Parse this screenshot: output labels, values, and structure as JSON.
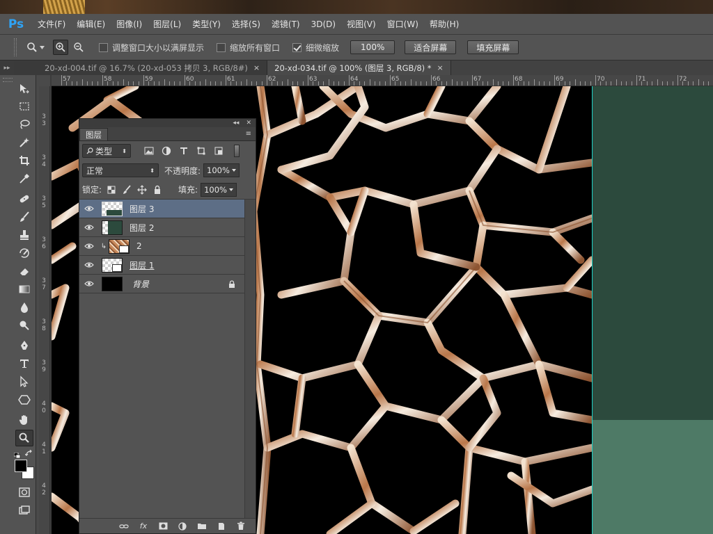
{
  "app": {
    "logo": "Ps"
  },
  "menu": [
    "文件(F)",
    "编辑(E)",
    "图像(I)",
    "图层(L)",
    "类型(Y)",
    "选择(S)",
    "滤镜(T)",
    "3D(D)",
    "视图(V)",
    "窗口(W)",
    "帮助(H)"
  ],
  "options": {
    "resize_windows": {
      "label": "调整窗口大小以满屏显示",
      "checked": false
    },
    "zoom_all": {
      "label": "缩放所有窗口",
      "checked": false
    },
    "scrubby_zoom": {
      "label": "细微缩放",
      "checked": true
    },
    "btn_100": "100%",
    "btn_fit": "适合屏幕",
    "btn_fill": "填充屏幕"
  },
  "tabs": [
    {
      "label": "20-xd-004.tif @ 16.7% (20-xd-053 拷贝 3, RGB/8#)",
      "close": "×",
      "active": false
    },
    {
      "label": "20-xd-034.tif @ 100% (图层 3, RGB/8) *",
      "close": "×",
      "active": true
    }
  ],
  "ruler_top": [
    "57",
    "58",
    "59",
    "60",
    "61",
    "62",
    "63",
    "64",
    "65",
    "66",
    "67",
    "68",
    "69",
    "70",
    "71",
    "72"
  ],
  "ruler_left": [
    "3",
    "3",
    "3",
    "4",
    "3",
    "5",
    "3",
    "6",
    "3",
    "7",
    "3",
    "8",
    "3",
    "9",
    "4",
    "0",
    "4",
    "1",
    "4",
    "2"
  ],
  "layers_panel": {
    "title": "图层",
    "filter_kind": "类型",
    "blend_mode": "正常",
    "opacity_label": "不透明度:",
    "opacity_value": "100%",
    "lock_label": "锁定:",
    "fill_label": "填充:",
    "fill_value": "100%",
    "layers": [
      {
        "name": "图层 3",
        "selected": true,
        "thumb": "checker-green"
      },
      {
        "name": "图层 2",
        "selected": false,
        "thumb": "checker-dark"
      },
      {
        "name": "2",
        "selected": false,
        "thumb": "copper-clipped"
      },
      {
        "name": "图层 1",
        "selected": false,
        "thumb": "checker-smart"
      },
      {
        "name": "背景",
        "selected": false,
        "thumb": "black",
        "locked": true
      }
    ]
  },
  "colors": {
    "canvas": "#000000",
    "green_panel": "#2c4a3d",
    "green_lower": "#4e7a66",
    "selected_layer": "#5d6e86",
    "crack_copper": "#c98a5c"
  }
}
